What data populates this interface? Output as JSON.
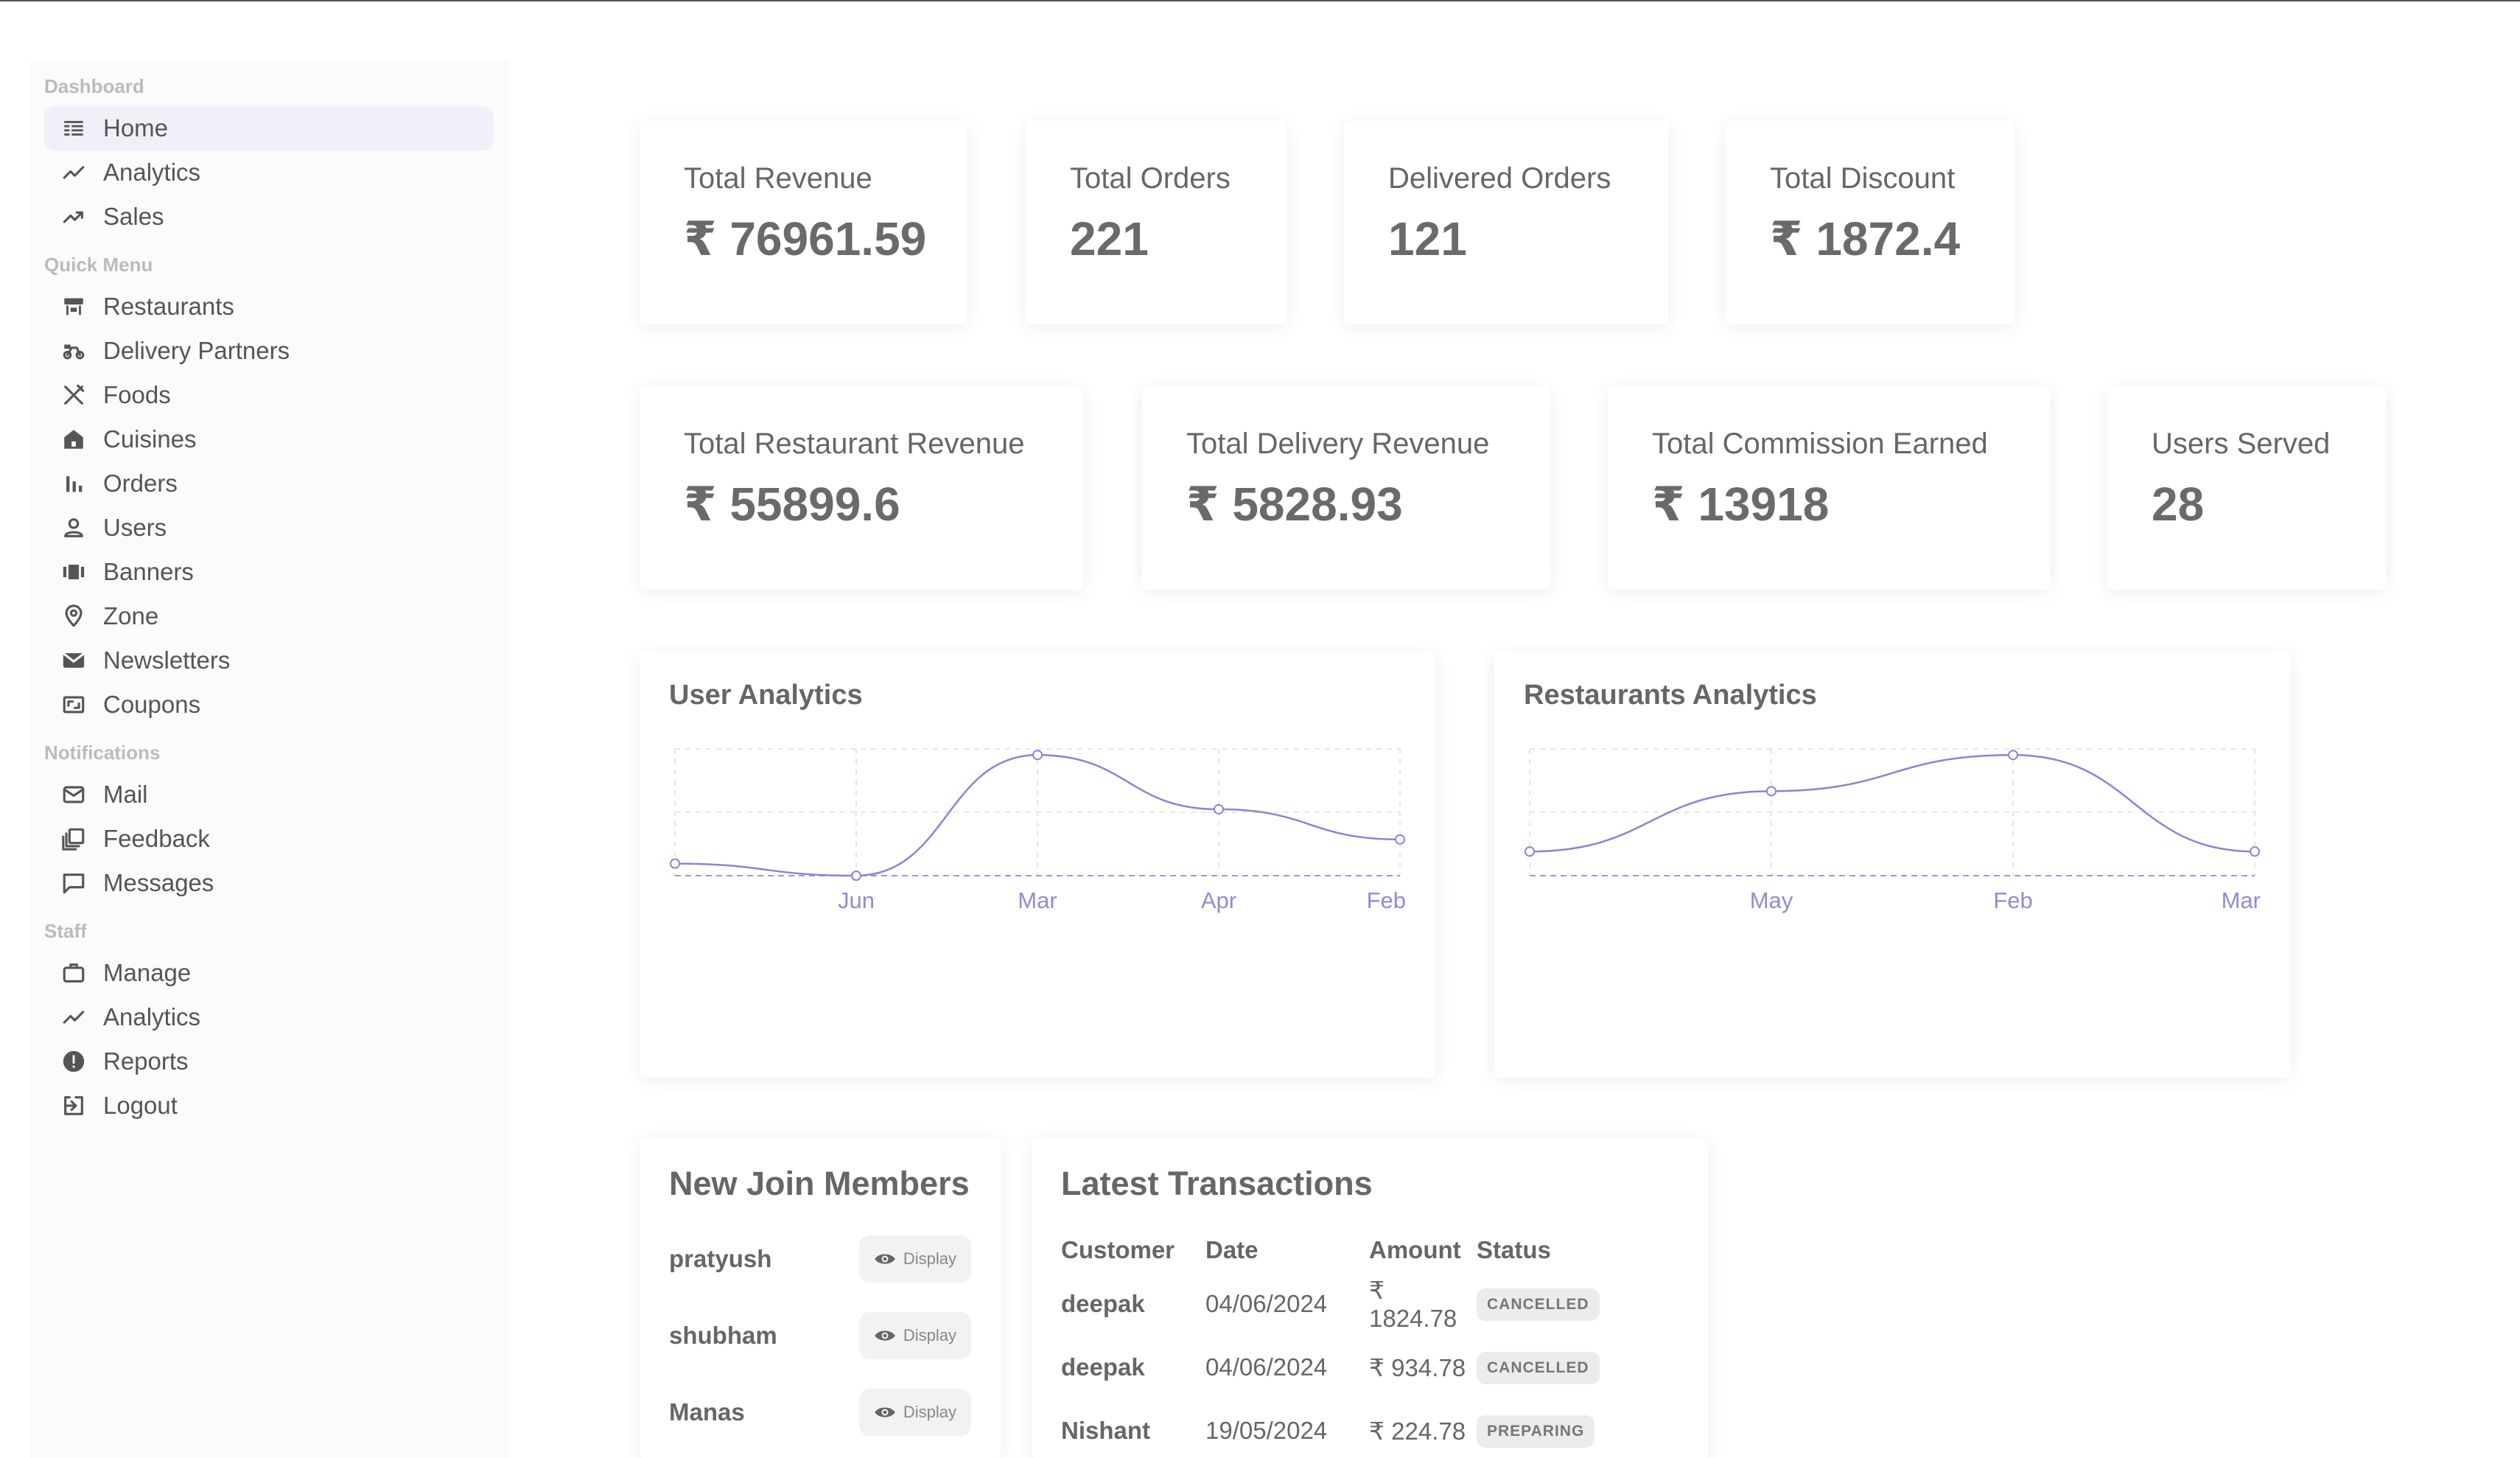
{
  "sidebar": {
    "sections": [
      {
        "title": "Dashboard",
        "items": [
          {
            "label": "Home",
            "icon": "home-icon"
          },
          {
            "label": "Analytics",
            "icon": "analytics-icon"
          },
          {
            "label": "Sales",
            "icon": "trending-up-icon"
          }
        ]
      },
      {
        "title": "Quick Menu",
        "items": [
          {
            "label": "Restaurants",
            "icon": "storefront-icon"
          },
          {
            "label": "Delivery Partners",
            "icon": "bike-icon"
          },
          {
            "label": "Foods",
            "icon": "utensils-icon"
          },
          {
            "label": "Cuisines",
            "icon": "house-icon"
          },
          {
            "label": "Orders",
            "icon": "bar-chart-icon"
          },
          {
            "label": "Users",
            "icon": "user-icon"
          },
          {
            "label": "Banners",
            "icon": "carousel-icon"
          },
          {
            "label": "Zone",
            "icon": "map-pin-icon"
          },
          {
            "label": "Newsletters",
            "icon": "envelope-icon"
          },
          {
            "label": "Coupons",
            "icon": "coupon-icon"
          }
        ]
      },
      {
        "title": "Notifications",
        "items": [
          {
            "label": "Mail",
            "icon": "mail-icon"
          },
          {
            "label": "Feedback",
            "icon": "feedback-icon"
          },
          {
            "label": "Messages",
            "icon": "chat-icon"
          }
        ]
      },
      {
        "title": "Staff",
        "items": [
          {
            "label": "Manage",
            "icon": "briefcase-icon"
          },
          {
            "label": "Analytics",
            "icon": "analytics-icon"
          },
          {
            "label": "Reports",
            "icon": "report-icon"
          },
          {
            "label": "Logout",
            "icon": "logout-icon"
          }
        ]
      }
    ]
  },
  "stats_row1": [
    {
      "label": "Total Revenue",
      "value": "₹ 76961.59"
    },
    {
      "label": "Total Orders",
      "value": "221"
    },
    {
      "label": "Delivered Orders",
      "value": "121"
    },
    {
      "label": "Total Discount",
      "value": "₹ 1872.4"
    }
  ],
  "stats_row2": [
    {
      "label": "Total Restaurant Revenue",
      "value": "₹ 55899.6"
    },
    {
      "label": "Total Delivery Revenue",
      "value": "₹ 5828.93"
    },
    {
      "label": "Total Commission Earned",
      "value": "₹ 13918"
    },
    {
      "label": "Users Served",
      "value": "28"
    }
  ],
  "chart_data": [
    {
      "type": "line",
      "title": "User Analytics",
      "categories": [
        "",
        "Jun",
        "Mar",
        "Apr",
        "Feb"
      ],
      "values": [
        1,
        0,
        10,
        5.5,
        3
      ],
      "ylim": [
        0,
        10.5
      ],
      "grid": true,
      "color": "#8884d8"
    },
    {
      "type": "line",
      "title": "Restaurants Analytics",
      "categories": [
        "",
        "May",
        "Feb",
        "Mar"
      ],
      "values": [
        2,
        7,
        10,
        2
      ],
      "ylim": [
        0,
        10.5
      ],
      "grid": true,
      "color": "#8884d8"
    }
  ],
  "members": {
    "title": "New Join Members",
    "button_label": "Display",
    "items": [
      "pratyush",
      "shubham",
      "Manas"
    ]
  },
  "transactions": {
    "title": "Latest Transactions",
    "headers": [
      "Customer",
      "Date",
      "Amount",
      "Status"
    ],
    "rows": [
      {
        "customer": "deepak",
        "date": "04/06/2024",
        "amount": "₹ 1824.78",
        "status": "CANCELLED"
      },
      {
        "customer": "deepak",
        "date": "04/06/2024",
        "amount": "₹ 934.78",
        "status": "CANCELLED"
      },
      {
        "customer": "Nishant",
        "date": "19/05/2024",
        "amount": "₹ 224.78",
        "status": "PREPARING"
      }
    ]
  },
  "colors": {
    "accent": "#8884d8",
    "badge_bg": "#ececec",
    "active_bg": "#f0f0f8"
  }
}
